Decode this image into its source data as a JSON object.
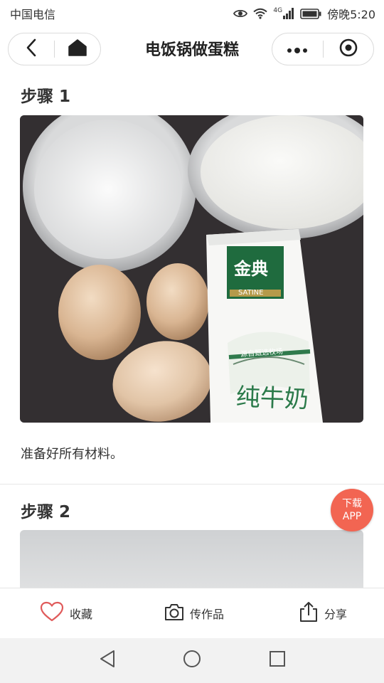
{
  "status_bar": {
    "carrier": "中国电信",
    "network_label": "4G",
    "time": "傍晚5:20",
    "icons": [
      "eye-icon",
      "wifi-icon",
      "cellular-signal-icon",
      "battery-icon"
    ]
  },
  "title_bar": {
    "title": "电饭锅做蛋糕",
    "icons": [
      "back-icon",
      "home-icon",
      "more-icon",
      "close-target-icon"
    ]
  },
  "steps": [
    {
      "title": "步骤 1",
      "text": "准备好所有材料。",
      "photo": {
        "brand_text": "金典",
        "brand_subtext": "SATINE",
        "product_slogan": "源自甄选牧场",
        "product_name": "纯牛奶"
      }
    },
    {
      "title": "步骤 2"
    }
  ],
  "download_fab": {
    "line1": "下载",
    "line2": "APP",
    "color": "#f26552"
  },
  "actions": {
    "favorite": "收藏",
    "upload": "传作品",
    "share": "分享",
    "favorite_color": "#e05a5a"
  },
  "system_nav": {
    "icons": [
      "nav-back-icon",
      "nav-home-icon",
      "nav-recents-icon"
    ]
  }
}
